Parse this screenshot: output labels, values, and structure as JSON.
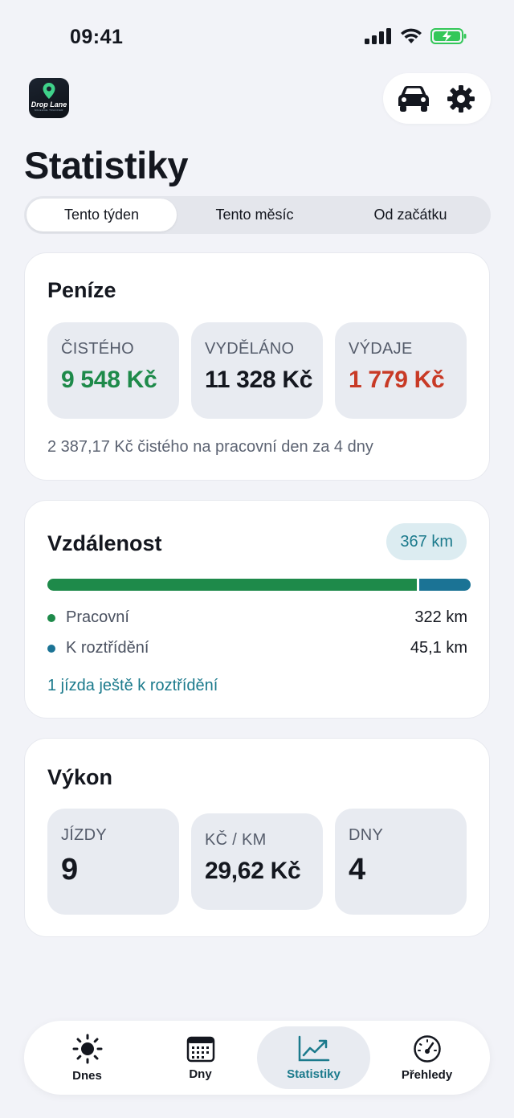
{
  "status": {
    "time": "09:41"
  },
  "header": {
    "logo_name": "Drop Lane",
    "logo_sub": "MILEAGE TRACKER",
    "title": "Statistiky"
  },
  "icons": {
    "car": "car-icon",
    "settings": "gear-icon"
  },
  "tabs": [
    {
      "label": "Tento týden",
      "active": true
    },
    {
      "label": "Tento měsíc",
      "active": false
    },
    {
      "label": "Od začátku",
      "active": false
    }
  ],
  "money": {
    "title": "Peníze",
    "net_label": "ČISTÉHO",
    "net_value": "9 548 Kč",
    "earned_label": "VYDĚLÁNO",
    "earned_value": "11 328 Kč",
    "expenses_label": "VÝDAJE",
    "expenses_value": "1 779 Kč",
    "note": "2 387,17 Kč čistého na pracovní den za 4 dny"
  },
  "distance": {
    "title": "Vzdálenost",
    "total": "367 km",
    "work_fraction": 0.877,
    "work_label": "Pracovní",
    "work_value": "322 km",
    "unsorted_label": "K roztřídění",
    "unsorted_value": "45,1 km",
    "link": "1 jízda ještě k roztřídění"
  },
  "performance": {
    "title": "Výkon",
    "rides_label": "JÍZDY",
    "rides_value": "9",
    "per_km_label": "KČ / KM",
    "per_km_value": "29,62 Kč",
    "days_label": "DNY",
    "days_value": "4"
  },
  "nav": [
    {
      "label": "Dnes",
      "icon": "sun-icon"
    },
    {
      "label": "Dny",
      "icon": "calendar-icon"
    },
    {
      "label": "Statistiky",
      "icon": "chart-icon",
      "active": true
    },
    {
      "label": "Přehledy",
      "icon": "speedometer-icon"
    }
  ],
  "colors": {
    "accent": "#1b7a8c",
    "positive": "#1e8a4a",
    "negative": "#c83a26"
  }
}
